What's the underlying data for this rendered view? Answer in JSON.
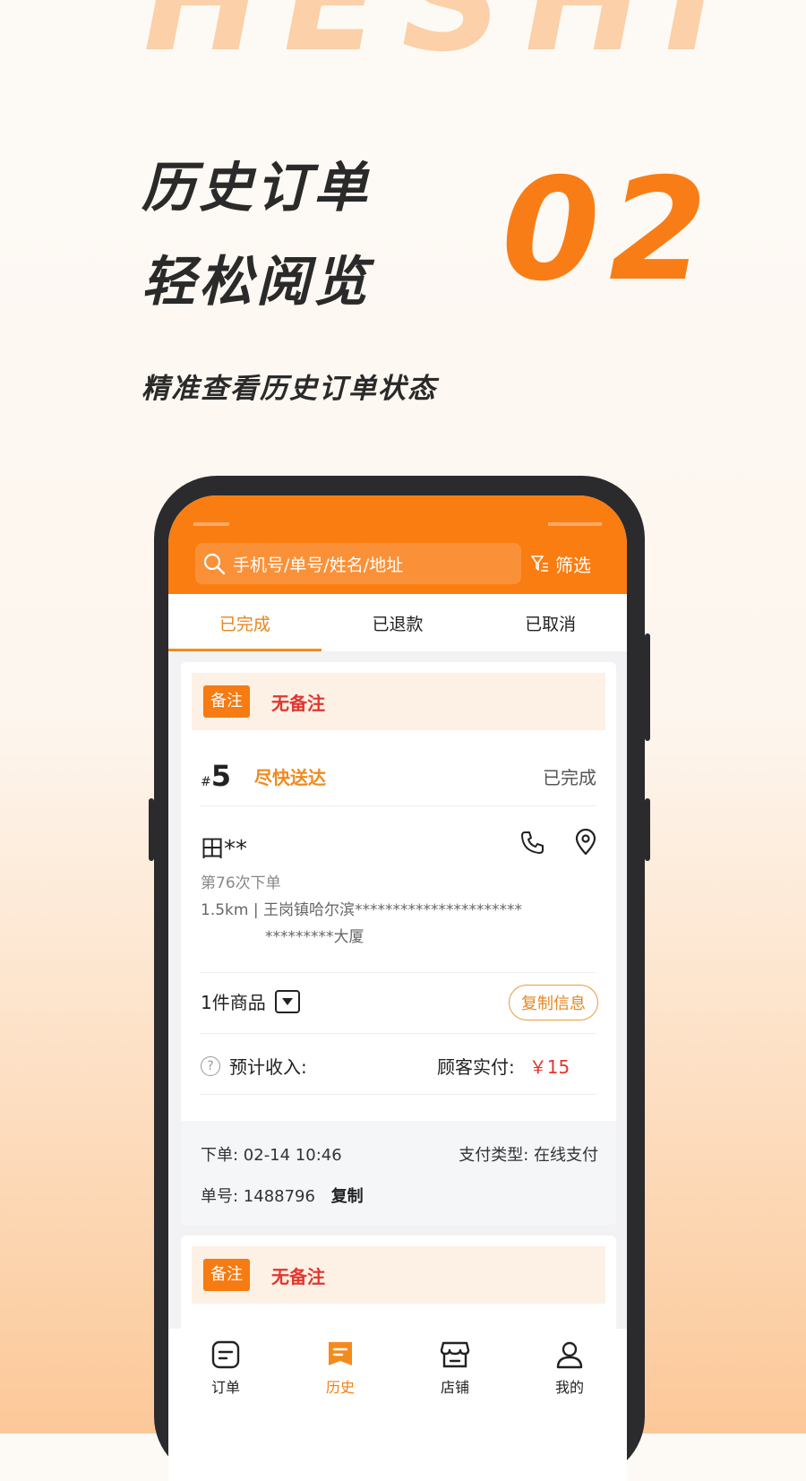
{
  "promo": {
    "brand": "HESHI",
    "headline_line1": "历史订单",
    "headline_line2": "轻松阅览",
    "number": "02",
    "subtitle": "精准查看历史订单状态"
  },
  "colors": {
    "accent": "#fa7d12",
    "danger": "#e1362f",
    "tab_active": "#e8851e"
  },
  "search": {
    "placeholder": "手机号/单号/姓名/地址",
    "filter_label": "筛选"
  },
  "tabs": [
    {
      "label": "已完成",
      "active": true
    },
    {
      "label": "已退款",
      "active": false
    },
    {
      "label": "已取消",
      "active": false
    }
  ],
  "order": {
    "note_tag": "备注",
    "note_text": "无备注",
    "hash": "#",
    "number": "5",
    "urgency": "尽快送达",
    "status": "已完成",
    "customer_name": "田**",
    "order_count": "第76次下单",
    "address_line1": "1.5km | 王岗镇哈尔滨**********************",
    "address_line2": "*********大厦",
    "items": "1件商品",
    "copy_info": "复制信息",
    "income_label": "预计收入:",
    "paid_label": "顾客实付:",
    "paid_value": "￥15",
    "order_time": "下单:  02-14 10:46",
    "pay_type": "支付类型:  在线支付",
    "order_no": "单号:  1488796",
    "copy_label": "复制"
  },
  "order2": {
    "note_tag": "备注",
    "note_text": "无备注"
  },
  "nav": [
    {
      "label": "订单",
      "icon": "order-icon",
      "active": false
    },
    {
      "label": "历史",
      "icon": "history-icon",
      "active": true
    },
    {
      "label": "店铺",
      "icon": "store-icon",
      "active": false
    },
    {
      "label": "我的",
      "icon": "profile-icon",
      "active": false
    }
  ]
}
